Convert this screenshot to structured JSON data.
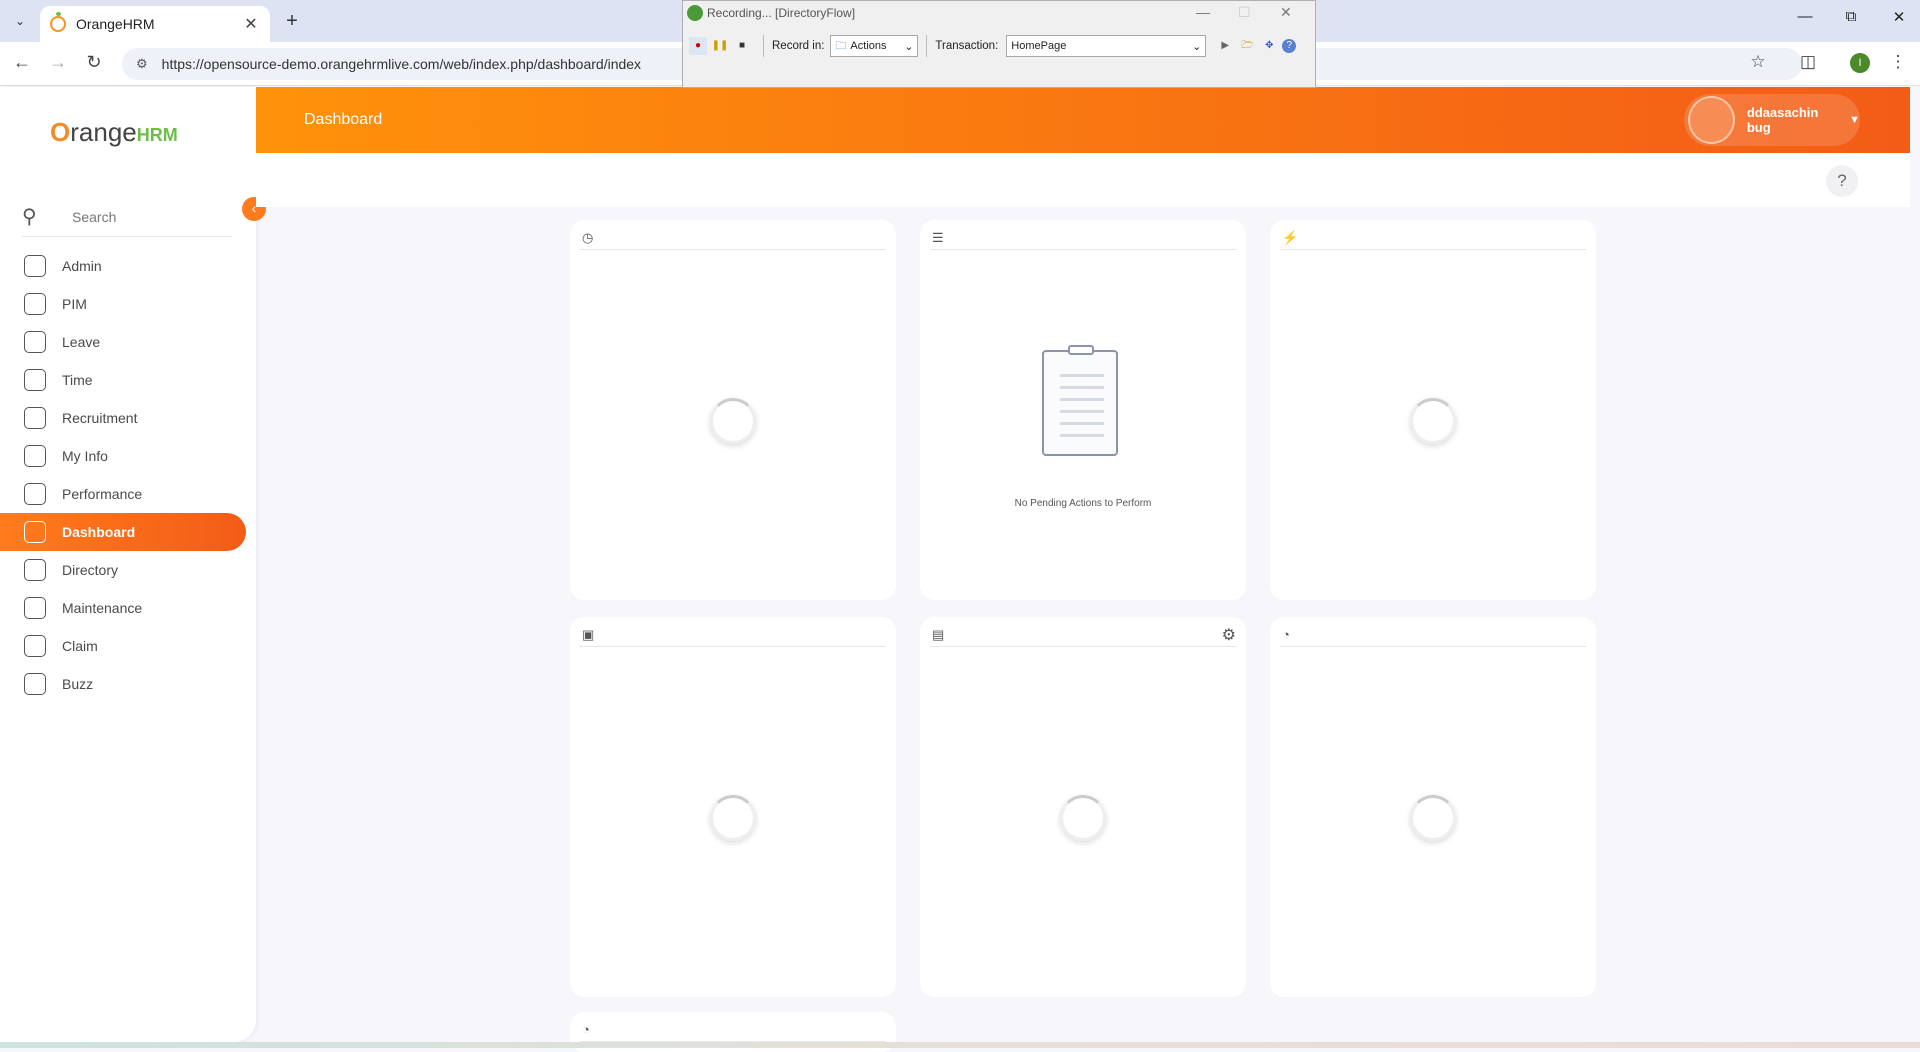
{
  "browser": {
    "tab_title": "OrangeHRM",
    "url": "https://opensource-demo.orangehrmlive.com/web/index.php/dashboard/index",
    "profile_initial": "I"
  },
  "recorder": {
    "title": "Recording... [DirectoryFlow]",
    "record_in_label": "Record in:",
    "record_in_value": "Actions",
    "transaction_label": "Transaction:",
    "transaction_value": "HomePage"
  },
  "sidebar": {
    "brand_o": "O",
    "brand_rest": "range",
    "brand_hrm": "HRM",
    "search_placeholder": "Search",
    "items": [
      {
        "label": "Admin",
        "icon": "admin-icon"
      },
      {
        "label": "PIM",
        "icon": "pim-icon"
      },
      {
        "label": "Leave",
        "icon": "leave-icon"
      },
      {
        "label": "Time",
        "icon": "time-icon"
      },
      {
        "label": "Recruitment",
        "icon": "recruitment-icon"
      },
      {
        "label": "My Info",
        "icon": "my-info-icon"
      },
      {
        "label": "Performance",
        "icon": "performance-icon"
      },
      {
        "label": "Dashboard",
        "icon": "home-icon",
        "active": true
      },
      {
        "label": "Directory",
        "icon": "directory-icon"
      },
      {
        "label": "Maintenance",
        "icon": "maintenance-icon"
      },
      {
        "label": "Claim",
        "icon": "claim-icon"
      },
      {
        "label": "Buzz",
        "icon": "buzz-icon"
      }
    ]
  },
  "header": {
    "page_title": "Dashboard",
    "user_name": "ddaasachin bug"
  },
  "dashboard": {
    "empty_message": "No Pending Actions to Perform"
  },
  "colors": {
    "accent": "#ff7b1d",
    "accent_dark": "#f35c17",
    "brand_green": "#6cbe45"
  }
}
